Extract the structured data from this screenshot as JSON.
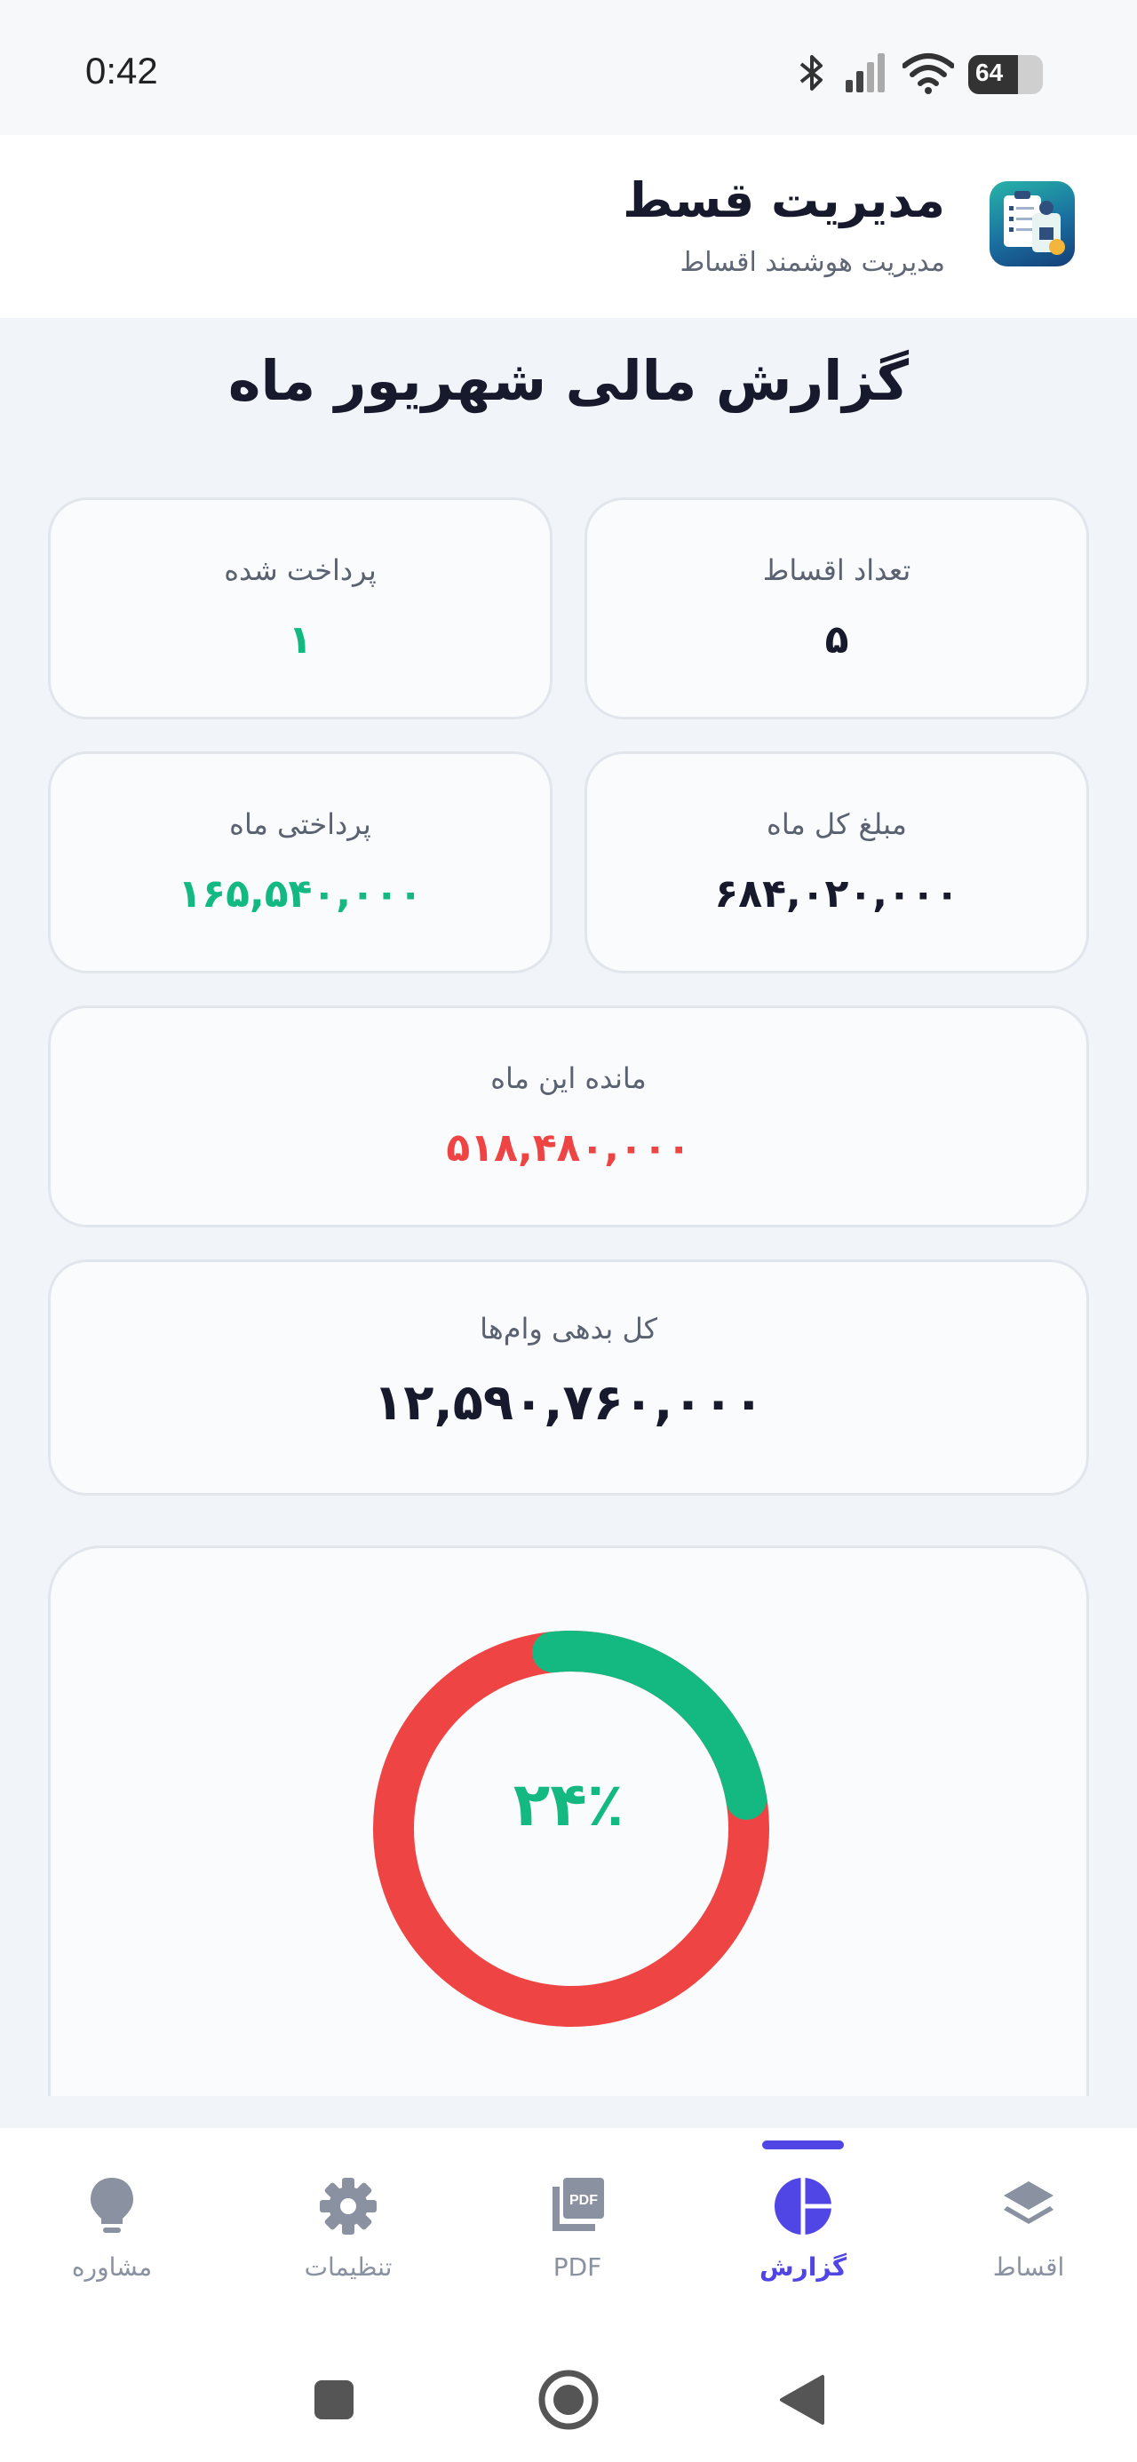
{
  "status_bar": {
    "time": "0:42",
    "battery": "64",
    "icons": [
      "bluetooth-icon",
      "signal-icon",
      "wifi-icon",
      "battery-icon"
    ]
  },
  "header": {
    "title": "مدیریت قسط",
    "subtitle": "مدیریت هوشمند اقساط"
  },
  "page_title": "گزارش مالی شهریور ماه",
  "cards": {
    "installment_count": {
      "label": "تعداد اقساط",
      "value": "۵"
    },
    "paid_count": {
      "label": "پرداخت شده",
      "value": "۱"
    },
    "month_total": {
      "label": "مبلغ کل ماه",
      "value": "۶۸۴,۰۲۰,۰۰۰"
    },
    "month_paid": {
      "label": "پرداختی ماه",
      "value": "۱۶۵,۵۴۰,۰۰۰"
    },
    "month_remaining": {
      "label": "مانده این ماه",
      "value": "۵۱۸,۴۸۰,۰۰۰"
    },
    "total_debt": {
      "label": "کل بدهی وام‌ها",
      "value": "۱۲,۵۹۰,۷۶۰,۰۰۰"
    }
  },
  "chart": {
    "percent_label": "۲۴٪",
    "paid_fraction": 0.24,
    "paid_color": "#14b981",
    "remaining_color": "#ef4444"
  },
  "bottom_nav": {
    "items": [
      {
        "label": "اقساط",
        "icon": "layers-icon",
        "active": false
      },
      {
        "label": "گزارش",
        "icon": "pie-chart-icon",
        "active": true
      },
      {
        "label": "PDF",
        "icon": "pdf-icon",
        "active": false
      },
      {
        "label": "تنظیمات",
        "icon": "gear-icon",
        "active": false
      },
      {
        "label": "مشاوره",
        "icon": "lightbulb-icon",
        "active": false
      }
    ],
    "active_color": "#4f46e5"
  },
  "system_nav": [
    "recents-button",
    "home-button",
    "back-button"
  ]
}
